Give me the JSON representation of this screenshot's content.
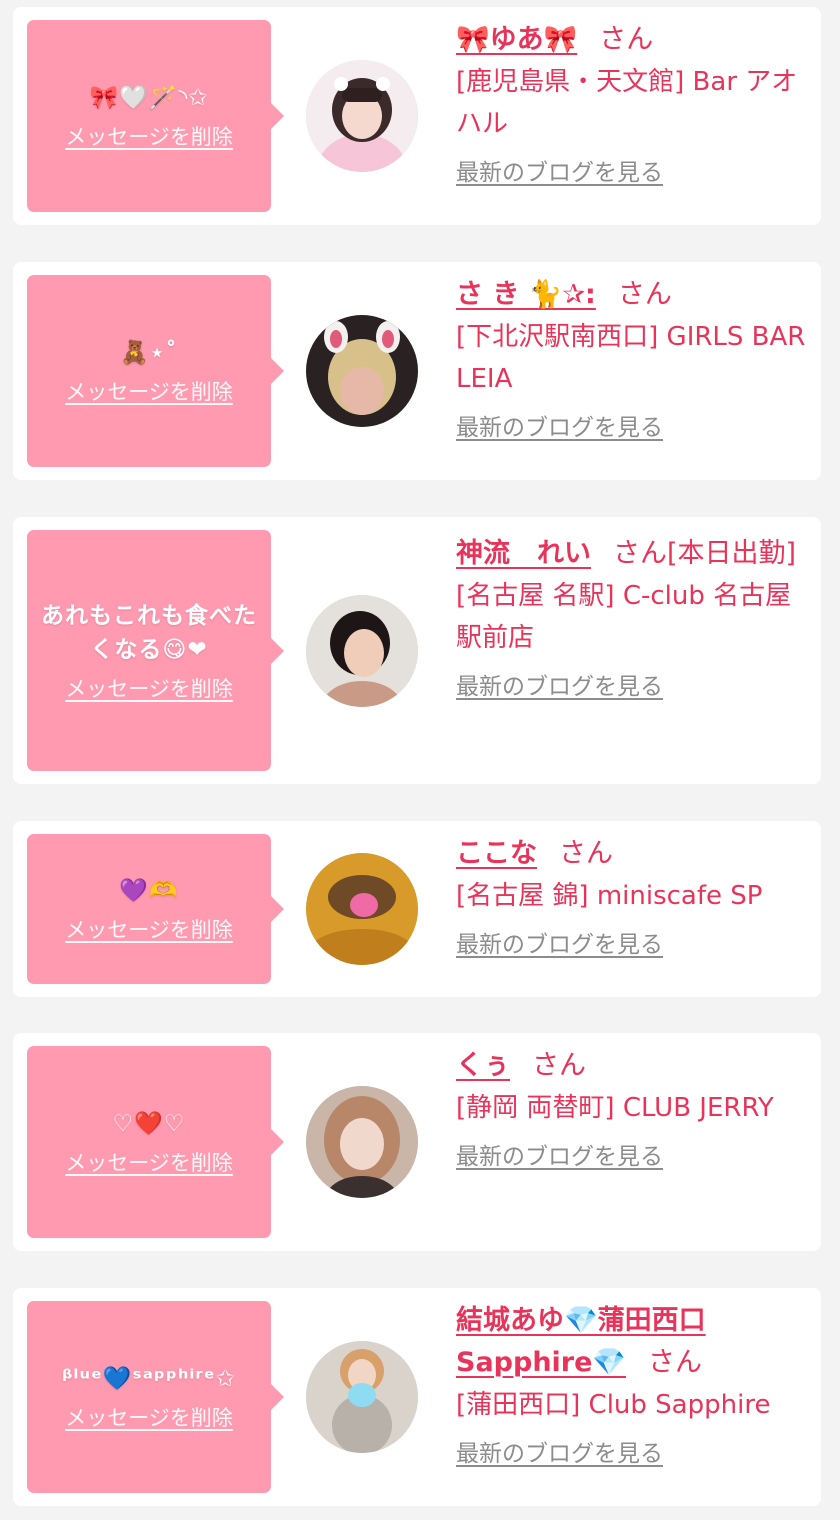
{
  "colors": {
    "page_background": "#f3f3f3",
    "card_background": "#ffffff",
    "bubble": "#ff9ab0",
    "accent_pink": "#e8345b",
    "link_gray": "#8c8c8c"
  },
  "common": {
    "delete_label": "メッセージを削除",
    "blog_label": "最新のブログを見る",
    "honorific": "さん"
  },
  "entries": [
    {
      "message": "🎀🤍🪄◝✩",
      "name": "🎀ゆあ🎀",
      "name_suffix": "",
      "shop": "[鹿児島県・天文館] Bar アオハル"
    },
    {
      "message": "🧸⋆˚",
      "name": "さ き 🐈✰:",
      "name_suffix": "",
      "shop": "[下北沢駅南西口] GIRLS BAR LEIA"
    },
    {
      "message": "あれもこれも食べたくなる😋❤",
      "name": "神流　れい",
      "name_suffix": "[本日出勤]",
      "shop": "[名古屋 名駅] C-club 名古屋駅前店"
    },
    {
      "message": "💜🫶",
      "name": "ここな",
      "name_suffix": "",
      "shop": "[名古屋 錦] miniscafe SP"
    },
    {
      "message": "♡❤️♡",
      "name": "くぅ",
      "name_suffix": "",
      "shop": "[静岡 両替町] CLUB JERRY"
    },
    {
      "message": "ᵝˡᵘᵉ💙ˢᵃᵖᵖʰⁱʳᵉ✩",
      "name": "結城あゆ💎蒲田西口Sapphire💎",
      "name_suffix": "",
      "shop": "[蒲田西口] Club Sapphire"
    }
  ]
}
